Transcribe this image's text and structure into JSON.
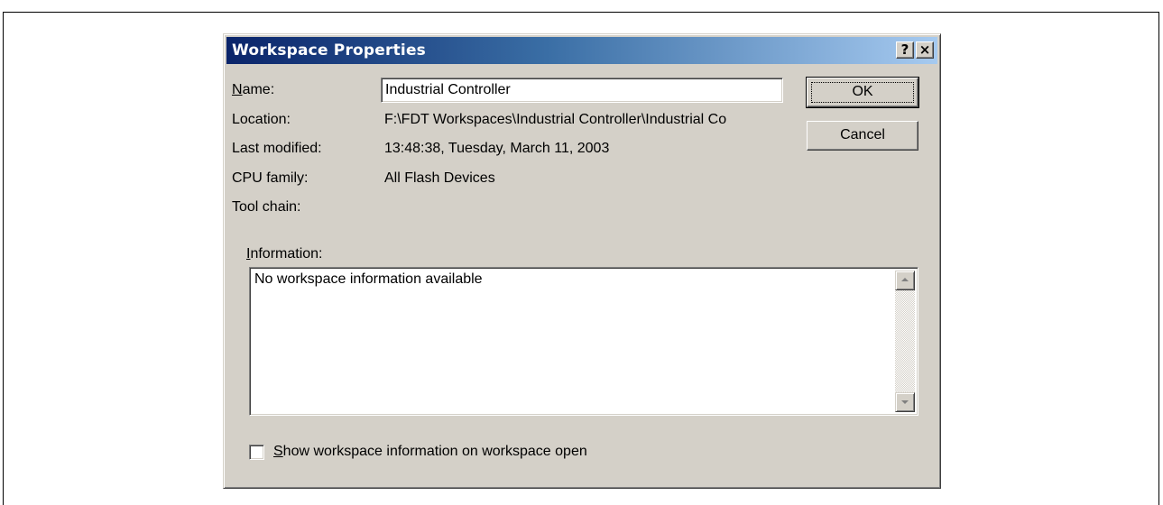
{
  "dialog": {
    "title": "Workspace Properties",
    "help_glyph": "?",
    "close_glyph": "×"
  },
  "fields": {
    "name_label_accel": "N",
    "name_label_rest": "ame:",
    "name_value": "Industrial Controller",
    "location_label": "Location:",
    "location_value": "F:\\FDT Workspaces\\Industrial Controller\\Industrial Co",
    "last_modified_label": "Last modified:",
    "last_modified_value": "13:48:38, Tuesday, March 11, 2003",
    "cpu_family_label": "CPU family:",
    "cpu_family_value": "All Flash Devices",
    "tool_chain_label": "Tool chain:",
    "tool_chain_value": ""
  },
  "information": {
    "label_accel": "I",
    "label_rest": "nformation:",
    "text": "No workspace information available"
  },
  "buttons": {
    "ok": "OK",
    "cancel": "Cancel"
  },
  "checkbox": {
    "label_accel": "S",
    "label_rest": "how workspace information on workspace open",
    "checked": false
  },
  "icons": [
    "help-icon",
    "close-icon",
    "scroll-up-icon",
    "scroll-down-icon"
  ]
}
